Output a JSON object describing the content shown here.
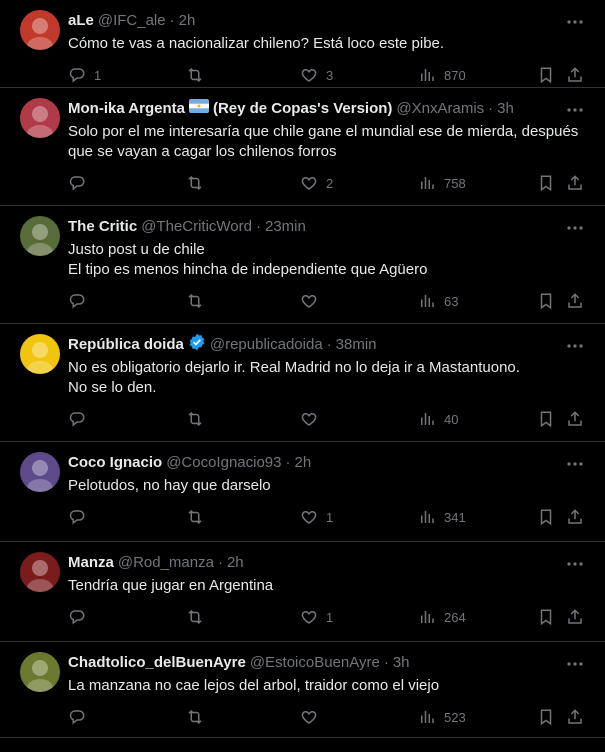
{
  "tweets": [
    {
      "name": "aLe",
      "handle": "@IFC_ale",
      "time": "2h",
      "lines": [
        "Cómo te vas a nacionalizar chileno? Está loco este pibe."
      ],
      "replies": "1",
      "retweets": "",
      "likes": "3",
      "views": "870",
      "avatar": "#c0392b",
      "badge": ""
    },
    {
      "name": "Mon-ika Argenta",
      "handle": "@XnxAramis",
      "time": "3h",
      "lines": [
        "Solo por el me interesaría que chile gane el mundial ese de mierda, después",
        "que se vayan a cagar los chilenos forros"
      ],
      "name_suffix": "(Rey de Copas's Version)",
      "replies": "",
      "retweets": "",
      "likes": "2",
      "views": "758",
      "avatar": "#b03a48",
      "badge": "flag-argentina-icon"
    },
    {
      "name": "The Critic",
      "handle": "@TheCriticWord",
      "time": "23min",
      "lines": [
        "Justo post u de chile",
        "El tipo es menos hincha de independiente que Agüero"
      ],
      "replies": "",
      "retweets": "",
      "likes": "",
      "views": "63",
      "avatar": "#5a6b3a",
      "badge": ""
    },
    {
      "name": "República doida",
      "handle": "@republicadoida",
      "time": "38min",
      "lines": [
        "No es obligatorio dejarlo ir. Real Madrid no lo deja ir a Mastantuono.",
        "No se lo den."
      ],
      "replies": "",
      "retweets": "",
      "likes": "",
      "views": "40",
      "avatar": "#f1c40f",
      "badge": "verified-icon"
    },
    {
      "name": "Coco Ignacio",
      "handle": "@CocoIgnacio93",
      "time": "2h",
      "lines": [
        "Pelotudos, no hay que darselo"
      ],
      "replies": "",
      "retweets": "",
      "likes": "1",
      "views": "341",
      "avatar": "#5d4a8a",
      "badge": ""
    },
    {
      "name": "Manza",
      "handle": "@Rod_manza",
      "time": "2h",
      "lines": [
        "Tendría que jugar en Argentina"
      ],
      "replies": "",
      "retweets": "",
      "likes": "1",
      "views": "264",
      "avatar": "#7b1c1c",
      "badge": ""
    },
    {
      "name": "Chadtolico_delBuenAyre",
      "handle": "@EstoicoBuenAyre",
      "time": "3h",
      "lines": [
        "La manzana no cae lejos del arbol, traidor como el viejo"
      ],
      "replies": "",
      "retweets": "",
      "likes": "",
      "views": "523",
      "avatar": "#6b7a2e",
      "badge": ""
    }
  ],
  "icons": {
    "reply": "reply-icon",
    "retweet": "retweet-icon",
    "like": "heart-icon",
    "views": "views-icon",
    "bookmark": "bookmark-icon",
    "share": "share-icon",
    "more": "more-icon"
  }
}
